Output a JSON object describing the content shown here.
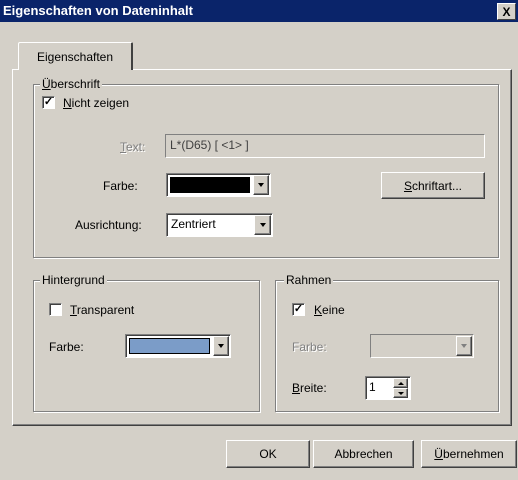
{
  "window": {
    "title": "Eigenschaften von Dateninhalt",
    "close_glyph": "X"
  },
  "tabs": [
    {
      "label": "Eigenschaften",
      "selected": true
    }
  ],
  "ueberschrift": {
    "legend_first": "Ü",
    "legend_rest": "berschrift",
    "nicht_zeigen": {
      "accel": "N",
      "label_rest": "icht zeigen",
      "checked": true
    },
    "text": {
      "label_accel": "T",
      "label_rest": "ext:",
      "value": "L*(D65) [ <1> ]"
    },
    "farbe": {
      "label": "Farbe:",
      "color": "#000000",
      "color_name": "black"
    },
    "schriftart_button": {
      "accel": "S",
      "rest": "chriftart..."
    },
    "ausrichtung": {
      "label": "Ausrichtung:",
      "value": "Zentriert"
    }
  },
  "hintergrund": {
    "legend": "Hintergrund",
    "transparent": {
      "accel": "T",
      "label_rest": "ransparent",
      "checked": false
    },
    "farbe": {
      "label": "Farbe:",
      "color": "#7b9cc8",
      "color_name": "steel-blue"
    }
  },
  "rahmen": {
    "legend": "Rahmen",
    "keine": {
      "accel": "K",
      "label_rest": "eine",
      "checked": true
    },
    "farbe": {
      "label": "Farbe:",
      "enabled": false
    },
    "breite": {
      "label_accel": "B",
      "label_rest": "reite:",
      "value": "1"
    }
  },
  "buttons": {
    "ok": "OK",
    "cancel": "Abbrechen",
    "apply_accel": "Ü",
    "apply_rest": "bernehmen"
  },
  "colors": {
    "face": "#d4d0c8",
    "title_bar": "#0a246a",
    "highlight": "#ffffff",
    "shadow": "#808080",
    "dark_shadow": "#404040"
  },
  "icons": {
    "checkbox_checked": "checkmark-icon",
    "dropdown": "chevron-down-icon",
    "spin_up": "spin-up-icon",
    "spin_down": "spin-down-icon",
    "close": "close-icon"
  }
}
